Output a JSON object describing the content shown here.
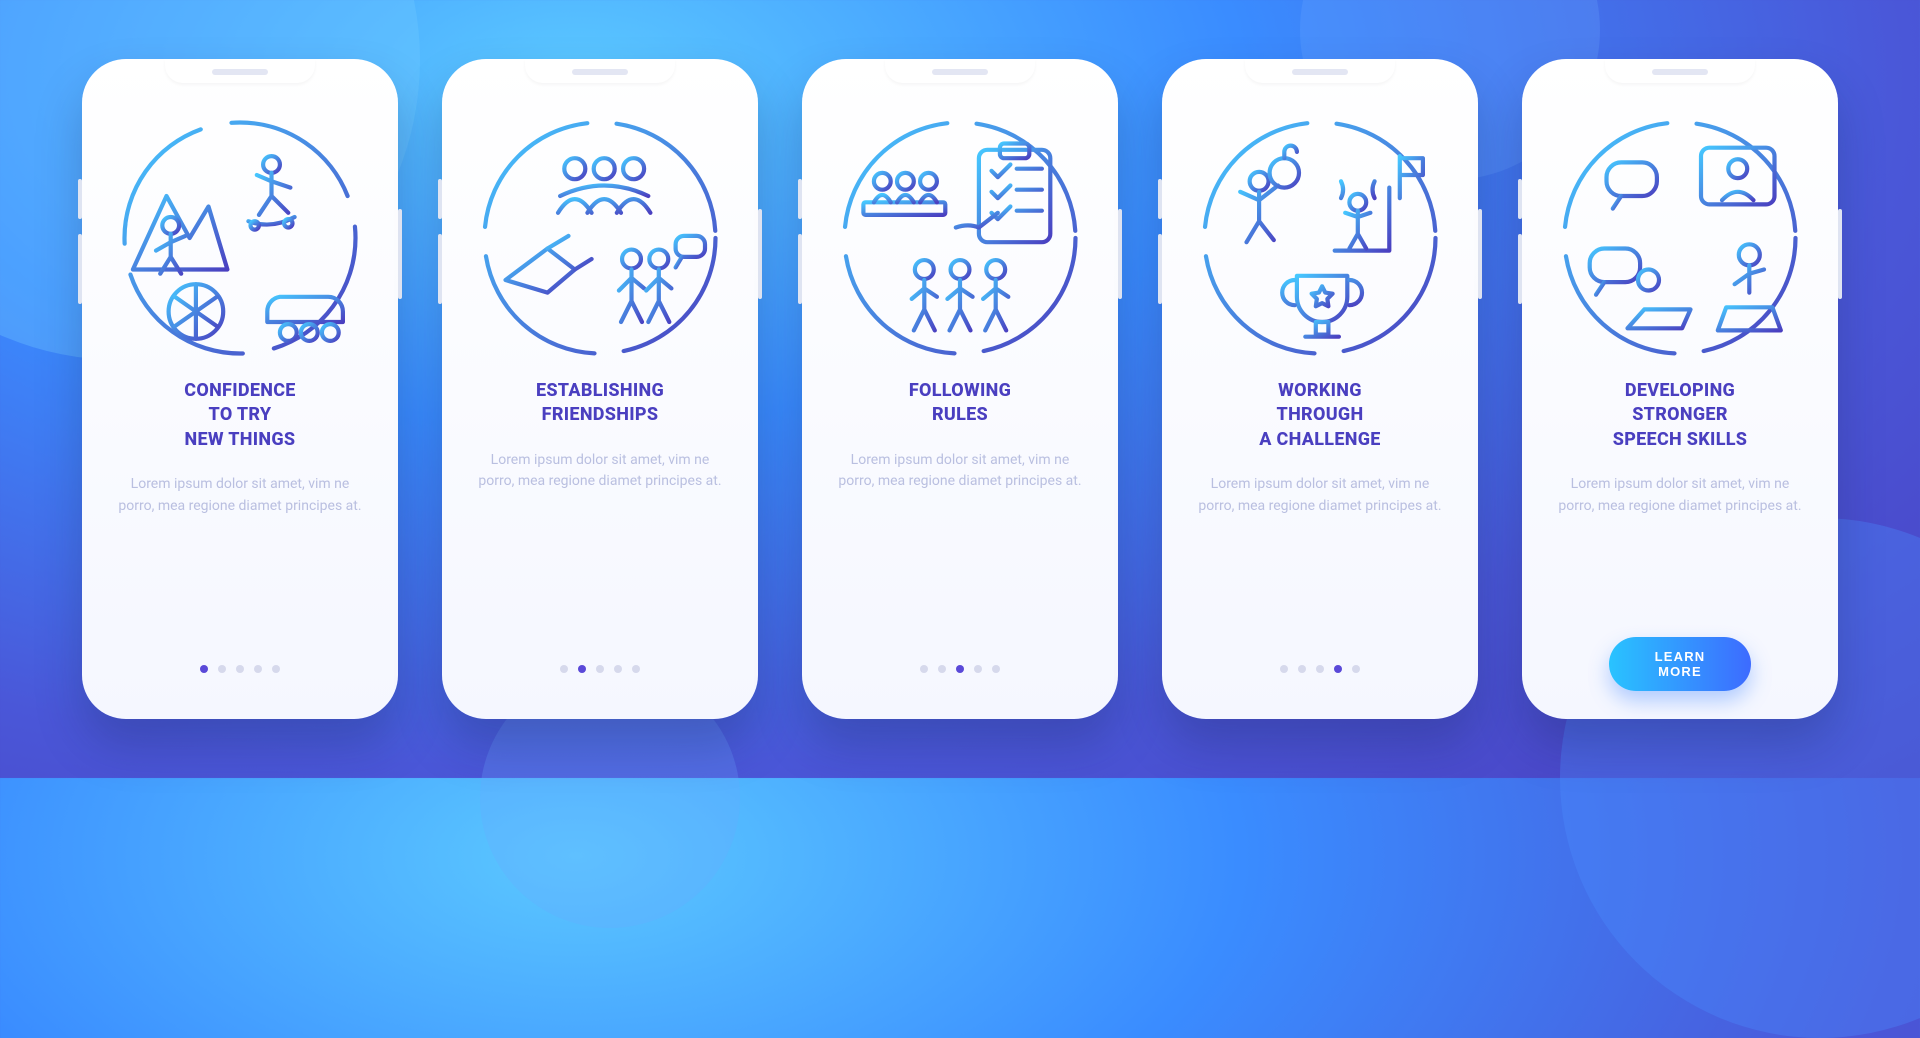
{
  "palette": {
    "heading": "#4a3fc0",
    "body": "#b9bfe0",
    "dot_inactive": "#d6d9ec",
    "dot_active": "#5a49d8",
    "cta_gradient_from": "#29c3ff",
    "cta_gradient_to": "#3d6bff",
    "stroke_gradient_from": "#46c8ff",
    "stroke_gradient_to": "#4a3fc0"
  },
  "shared": {
    "description": "Lorem ipsum dolor sit amet, vim ne porro, mea regione diamet principes at.",
    "total_slides": 5
  },
  "cta": {
    "label": "LEARN MORE"
  },
  "screens": [
    {
      "title": "CONFIDENCE\nTO TRY\nNEW THINGS",
      "icon": "sports-activities-icon",
      "active_index": 0
    },
    {
      "title": "ESTABLISHING\nFRIENDSHIPS",
      "icon": "friendship-handshake-icon",
      "active_index": 1
    },
    {
      "title": "FOLLOWING\nRULES",
      "icon": "checklist-team-icon",
      "active_index": 2
    },
    {
      "title": "WORKING\nTHROUGH\nA CHALLENGE",
      "icon": "challenge-trophy-icon",
      "active_index": 3
    },
    {
      "title": "DEVELOPING\nSTRONGER\nSPEECH SKILLS",
      "icon": "conversation-speech-icon",
      "active_index": 4
    }
  ]
}
